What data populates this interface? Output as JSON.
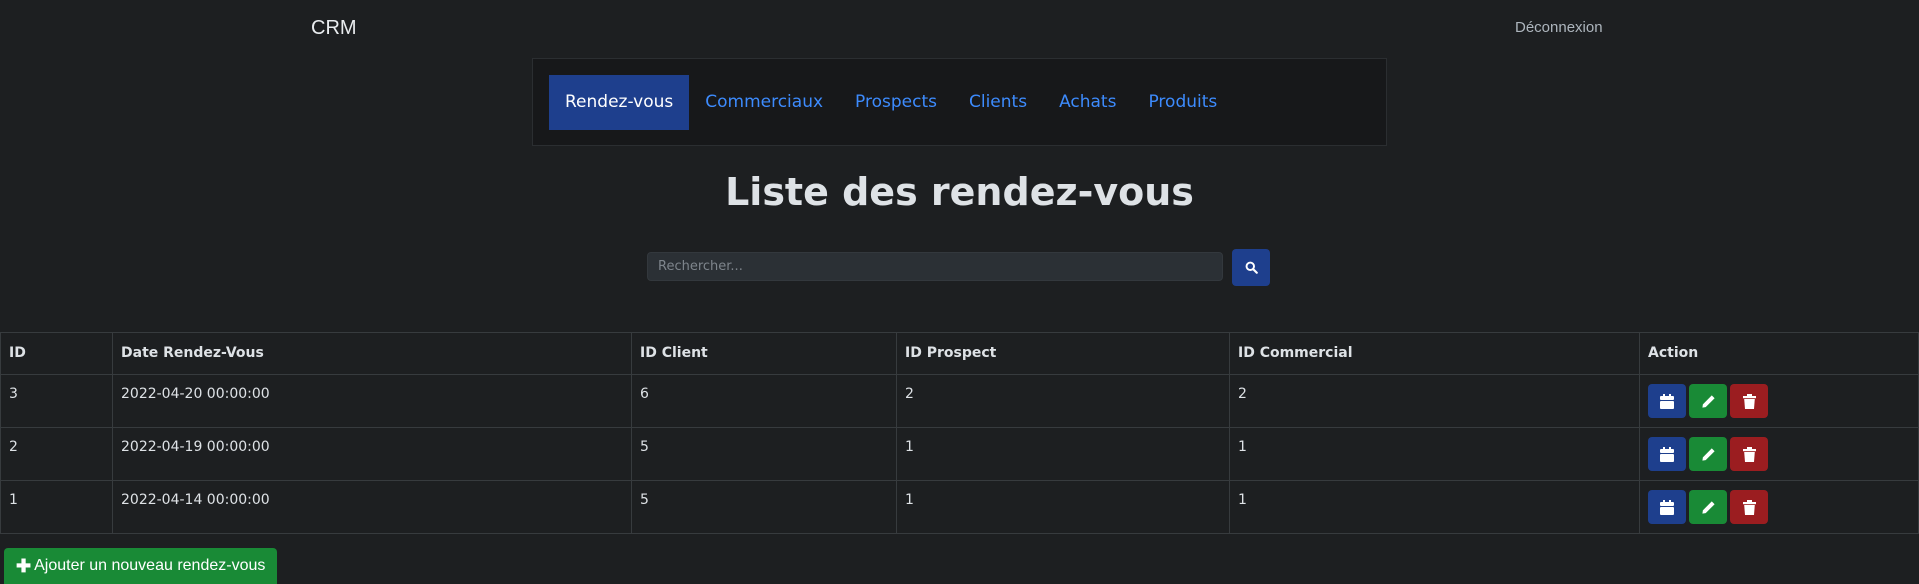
{
  "app": {
    "brand": "CRM",
    "logout_label": "Déconnexion"
  },
  "nav": {
    "items": [
      {
        "label": "Rendez-vous",
        "active": true
      },
      {
        "label": "Commerciaux",
        "active": false
      },
      {
        "label": "Prospects",
        "active": false
      },
      {
        "label": "Clients",
        "active": false
      },
      {
        "label": "Achats",
        "active": false
      },
      {
        "label": "Produits",
        "active": false
      }
    ]
  },
  "page": {
    "title": "Liste des rendez-vous"
  },
  "search": {
    "placeholder": "Rechercher...",
    "value": "",
    "button_icon": "search-icon"
  },
  "table": {
    "headers": [
      "ID",
      "Date Rendez-Vous",
      "ID Client",
      "ID Prospect",
      "ID Commercial",
      "Action"
    ],
    "rows": [
      {
        "id": "3",
        "date": "2022-04-20 00:00:00",
        "client": "6",
        "prospect": "2",
        "commercial": "2"
      },
      {
        "id": "2",
        "date": "2022-04-19 00:00:00",
        "client": "5",
        "prospect": "1",
        "commercial": "1"
      },
      {
        "id": "1",
        "date": "2022-04-14 00:00:00",
        "client": "5",
        "prospect": "1",
        "commercial": "1"
      }
    ],
    "row_actions": [
      {
        "icon": "calendar-icon",
        "color": "#1e3f8d"
      },
      {
        "icon": "pencil-icon",
        "color": "#198a36"
      },
      {
        "icon": "trash-icon",
        "color": "#9b1d20"
      }
    ]
  },
  "add_button": {
    "icon": "plus-icon",
    "label": "Ajouter un nouveau rendez-vous"
  },
  "colors": {
    "background": "#1d1f21",
    "primary": "#1e3f8d",
    "success": "#198a36",
    "danger": "#9b1d20",
    "link": "#3d8bfd"
  }
}
